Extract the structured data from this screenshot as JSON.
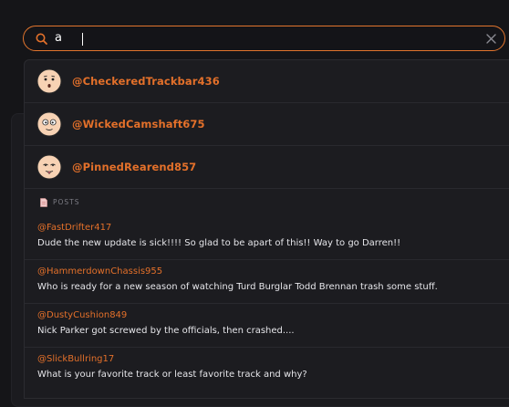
{
  "search": {
    "value": "a",
    "placeholder": ""
  },
  "colors": {
    "accent": "#e3702a",
    "background": "#151518",
    "dropdown": "#1c1c20"
  },
  "users": [
    {
      "handle": "@CheckeredTrackbar436",
      "avatar": "face-surprised-avatar"
    },
    {
      "handle": "@WickedCamshaft675",
      "avatar": "face-wide-eyes-avatar"
    },
    {
      "handle": "@PinnedRearend857",
      "avatar": "face-tongue-avatar"
    }
  ],
  "posts_section": {
    "label": "POSTS",
    "icon": "document-icon"
  },
  "posts": [
    {
      "author": "@FastDrifter417",
      "text": "Dude the new update is sick!!!! So glad to be apart of this!! Way to go Darren!!"
    },
    {
      "author": "@HammerdownChassis955",
      "text": "Who is ready for a new season of watching Turd Burglar Todd Brennan trash some stuff."
    },
    {
      "author": "@DustyCushion849",
      "text": "Nick Parker got screwed by the officials, then crashed...."
    },
    {
      "author": "@SlickBullring17",
      "text": "What is your favorite track or least favorite track and why?"
    }
  ]
}
